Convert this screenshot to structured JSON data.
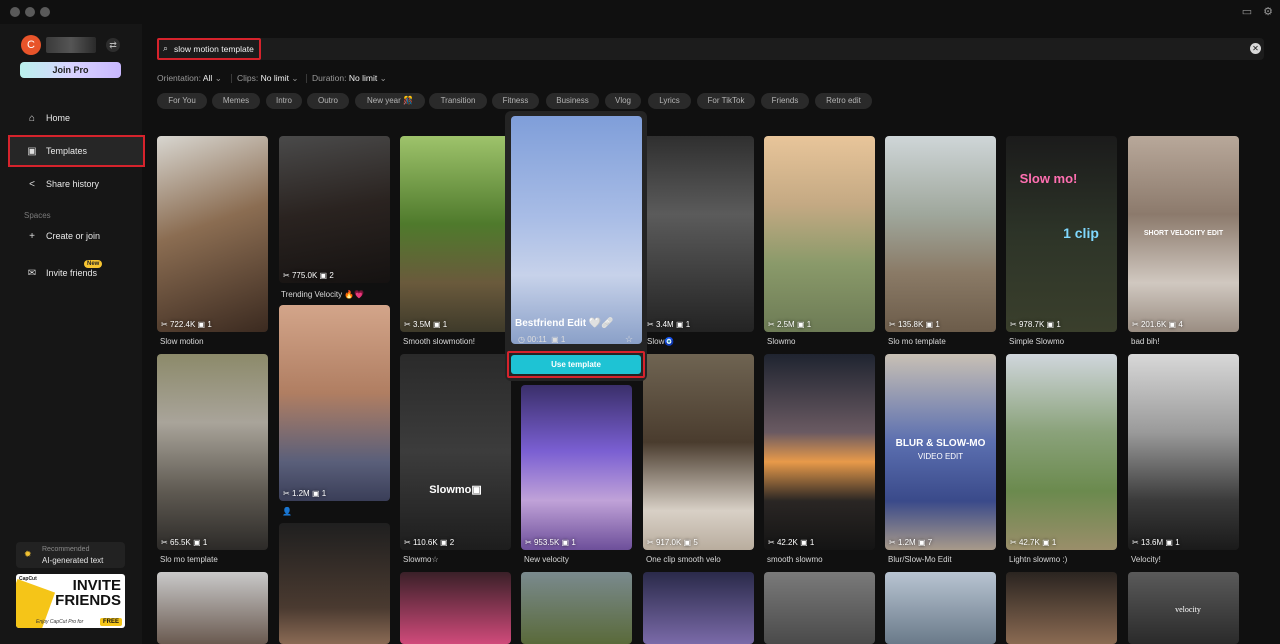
{
  "sidebar": {
    "avatar_letter": "C",
    "join_pro": "Join Pro",
    "nav": [
      {
        "label": "Home"
      },
      {
        "label": "Templates"
      },
      {
        "label": "Share history"
      }
    ],
    "spaces_label": "Spaces",
    "create_or_join": "Create or join",
    "invite_friends": "Invite friends",
    "new_badge": "New",
    "recommended": {
      "label": "Recommended",
      "text": "AI-generated text"
    },
    "banner": {
      "brand": "CapCut",
      "big_line1": "INVITE",
      "big_line2": "FRIENDS",
      "small": "Enjoy CapCut Pro for",
      "free": "FREE"
    }
  },
  "search": {
    "value": "slow motion template"
  },
  "filters": [
    {
      "label": "Orientation:",
      "value": "All"
    },
    {
      "label": "Clips:",
      "value": "No limit"
    },
    {
      "label": "Duration:",
      "value": "No limit"
    }
  ],
  "chips": [
    "For You",
    "Memes",
    "Intro",
    "Outro",
    "New year 🎊",
    "Transition",
    "Fitness",
    "Business",
    "Vlog",
    "Lyrics",
    "For TikTok",
    "Friends",
    "Retro edit"
  ],
  "popup": {
    "title": "Bestfriend Edit 🤍🩹",
    "duration": "00:11",
    "clips": "1",
    "use_template": "Use template"
  },
  "cards": [
    {
      "uses": "722.4K",
      "clips": "1",
      "title": "Slow motion"
    },
    {
      "uses": "775.0K",
      "clips": "2",
      "title": "Trending Velocity 🔥💗"
    },
    {
      "uses": "3.5M",
      "clips": "1",
      "title": "Smooth slowmotion!"
    },
    {
      "uses": "3.4M",
      "clips": "1",
      "title": "Slow🧿"
    },
    {
      "uses": "2.5M",
      "clips": "1",
      "title": "Slowmo"
    },
    {
      "uses": "135.8K",
      "clips": "1",
      "title": "Slo mo template"
    },
    {
      "uses": "978.7K",
      "clips": "1",
      "title": "Simple Slowmo",
      "overlay1": "Slow mo!",
      "overlay2": "1 clip"
    },
    {
      "uses": "201.6K",
      "clips": "4",
      "title": "bad bih!",
      "overlay1": "SHORT VELOCITY EDIT"
    },
    {
      "uses": "65.5K",
      "clips": "1",
      "title": "Slo mo template"
    },
    {
      "uses": "1.2M",
      "clips": "1",
      "title": "👤"
    },
    {
      "uses": "110.6K",
      "clips": "2",
      "title": "Slowmo☆",
      "overlay1": "Slowmo▣"
    },
    {
      "uses": "953.5K",
      "clips": "1",
      "title": "New velocity"
    },
    {
      "uses": "917.0K",
      "clips": "5",
      "title": "One clip smooth velo"
    },
    {
      "uses": "42.2K",
      "clips": "1",
      "title": "smooth slowmo"
    },
    {
      "uses": "1.2M",
      "clips": "7",
      "title": "Blur/Slow-Mo Edit",
      "overlay1": "BLUR & SLOW-MO",
      "overlay2": "VIDEO EDIT"
    },
    {
      "uses": "42.7K",
      "clips": "1",
      "title": "Lightn slowmo :)"
    },
    {
      "uses": "13.6M",
      "clips": "1",
      "title": "Velocity!"
    },
    {
      "overlay1": "velocity"
    }
  ]
}
